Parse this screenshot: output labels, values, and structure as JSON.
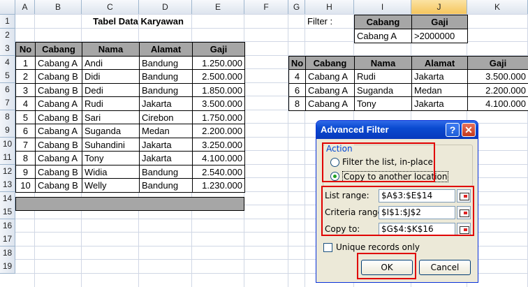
{
  "columns": [
    "A",
    "B",
    "C",
    "D",
    "E",
    "F",
    "G",
    "H",
    "I",
    "J",
    "K"
  ],
  "selected_column": "J",
  "rows": [
    "1",
    "2",
    "3",
    "4",
    "5",
    "6",
    "7",
    "8",
    "9",
    "10",
    "11",
    "12",
    "13",
    "14",
    "15",
    "16",
    "17",
    "18",
    "19"
  ],
  "title": "Tabel Data Karyawan",
  "filter_label": "Filter :",
  "criteria": {
    "headers": [
      "Cabang",
      "Gaji"
    ],
    "values": [
      "Cabang A",
      ">2000000"
    ]
  },
  "main_table": {
    "headers": [
      "No",
      "Cabang",
      "Nama",
      "Alamat",
      "Gaji"
    ],
    "rows": [
      [
        "1",
        "Cabang A",
        "Andi",
        "Bandung",
        "1.250.000"
      ],
      [
        "2",
        "Cabang B",
        "Didi",
        "Bandung",
        "2.500.000"
      ],
      [
        "3",
        "Cabang B",
        "Dedi",
        "Bandung",
        "1.850.000"
      ],
      [
        "4",
        "Cabang A",
        "Rudi",
        "Jakarta",
        "3.500.000"
      ],
      [
        "5",
        "Cabang B",
        "Sari",
        "Cirebon",
        "1.750.000"
      ],
      [
        "6",
        "Cabang A",
        "Suganda",
        "Medan",
        "2.200.000"
      ],
      [
        "7",
        "Cabang B",
        "Suhandini",
        "Jakarta",
        "3.250.000"
      ],
      [
        "8",
        "Cabang A",
        "Tony",
        "Jakarta",
        "4.100.000"
      ],
      [
        "9",
        "Cabang B",
        "Widia",
        "Bandung",
        "2.540.000"
      ],
      [
        "10",
        "Cabang B",
        "Welly",
        "Bandung",
        "1.230.000"
      ]
    ]
  },
  "result_table": {
    "headers": [
      "No",
      "Cabang",
      "Nama",
      "Alamat",
      "Gaji"
    ],
    "rows": [
      [
        "4",
        "Cabang A",
        "Rudi",
        "Jakarta",
        "3.500.000"
      ],
      [
        "6",
        "Cabang A",
        "Suganda",
        "Medan",
        "2.200.000"
      ],
      [
        "8",
        "Cabang A",
        "Tony",
        "Jakarta",
        "4.100.000"
      ]
    ]
  },
  "dialog": {
    "title": "Advanced Filter",
    "help": "?",
    "close": "✕",
    "action_label": "Action",
    "option_inplace": "Filter the list, in-place",
    "option_copy": "Copy to another location",
    "selected_option": "copy",
    "list_range_label": "List range:",
    "list_range_value": "$A$3:$E$14",
    "criteria_range_label": "Criteria range:",
    "criteria_range_value": "$I$1:$J$2",
    "copy_to_label": "Copy to:",
    "copy_to_value": "$G$4:$K$16",
    "unique_label": "Unique records only",
    "unique_checked": false,
    "ok": "OK",
    "cancel": "Cancel"
  },
  "colors": {
    "header_gray": "#a6a6a6",
    "highlight_red": "#e00000",
    "title_blue": "#0a4ad0",
    "dialog_bg": "#ece9d8"
  }
}
